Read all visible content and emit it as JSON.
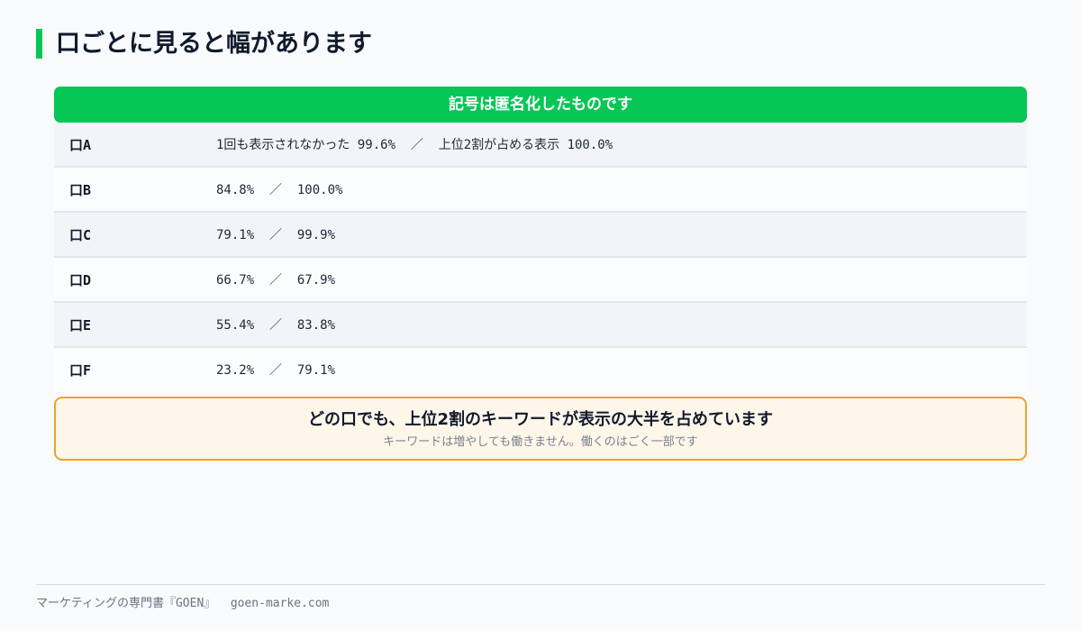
{
  "title": "口ごとに見ると幅があります",
  "table": {
    "header": "記号は匿名化したものです",
    "rows": [
      {
        "label": "口A",
        "value": "1回も表示されなかった 99.6%  ／  上位2割が占める表示 100.0%"
      },
      {
        "label": "口B",
        "value": "84.8%  ／  100.0%"
      },
      {
        "label": "口C",
        "value": "79.1%  ／  99.9%"
      },
      {
        "label": "口D",
        "value": "66.7%  ／  67.9%"
      },
      {
        "label": "口E",
        "value": "55.4%  ／  83.8%"
      },
      {
        "label": "口F",
        "value": "23.2%  ／  79.1%"
      }
    ]
  },
  "callout": {
    "main": "どの口でも、上位2割のキーワードが表示の大半を占めています",
    "sub": "キーワードは増やしても働きません。働くのはごく一部です"
  },
  "footer": {
    "brand": "マーケティングの専門書『GOEN』",
    "url": "goen-marke.com"
  },
  "colors": {
    "accent": "#06c755",
    "callout_border": "#f0a12b",
    "callout_bg": "#fff6ea"
  }
}
